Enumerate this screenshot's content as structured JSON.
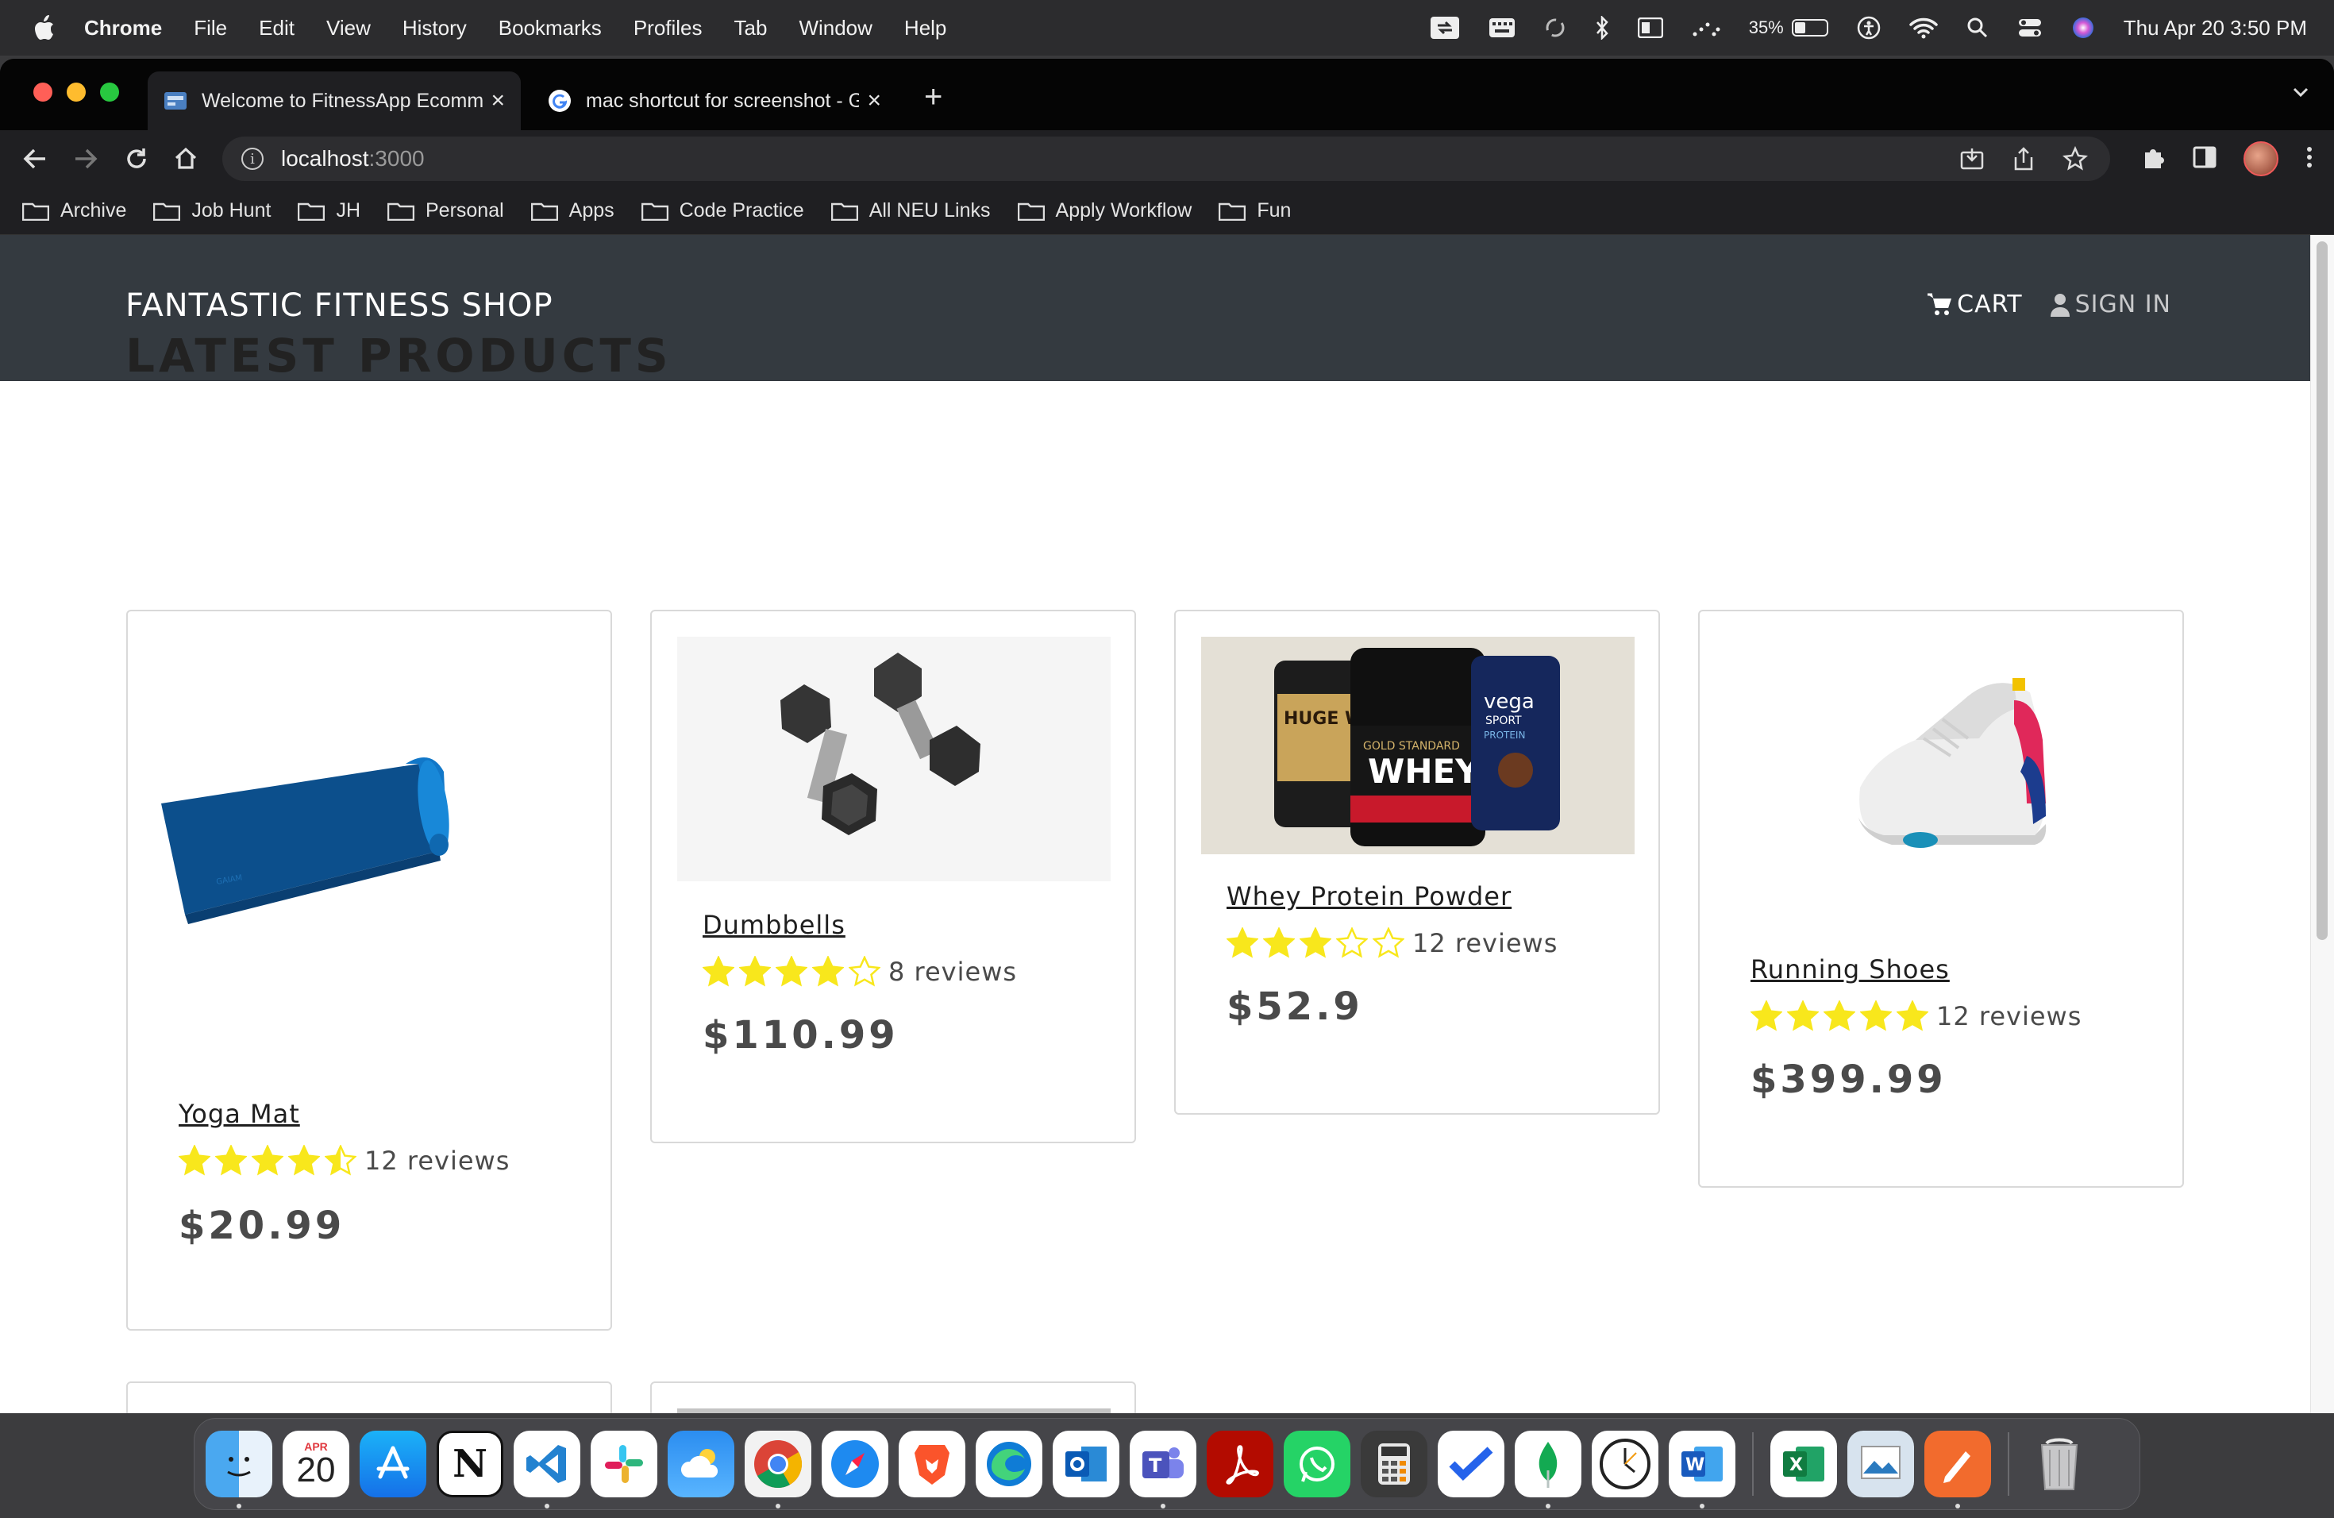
{
  "menubar": {
    "app_name": "Chrome",
    "items": [
      "File",
      "Edit",
      "View",
      "History",
      "Bookmarks",
      "Profiles",
      "Tab",
      "Window",
      "Help"
    ],
    "battery_percent": "35%",
    "battery_level": 0.35,
    "datetime": "Thu Apr 20  3:50 PM"
  },
  "browser": {
    "tabs": [
      {
        "title": "Welcome to FitnessApp Ecomm",
        "active": true,
        "favicon": "site-favicon"
      },
      {
        "title": "mac shortcut for screenshot - G",
        "active": false,
        "favicon": "google-icon"
      }
    ],
    "address": {
      "host": "localhost",
      "port": ":3000"
    },
    "bookmarks": [
      "Archive",
      "Job Hunt",
      "JH",
      "Personal",
      "Apps",
      "Code Practice",
      "All NEU Links",
      "Apply Workflow",
      "Fun"
    ]
  },
  "site": {
    "brand": "FANTASTIC FITNESS SHOP",
    "nav": {
      "cart": "CART",
      "sign_in": "SIGN IN"
    },
    "section_title": "LATEST PRODUCTS",
    "products": [
      {
        "name": "Yoga Mat",
        "rating": 4.5,
        "reviews": "12 reviews",
        "price": "$20.99",
        "image": "yoga-mat"
      },
      {
        "name": "Dumbbells",
        "rating": 4,
        "reviews": "8 reviews",
        "price": "$110.99",
        "image": "dumbbells"
      },
      {
        "name": "Whey Protein Powder",
        "rating": 3,
        "reviews": "12 reviews",
        "price": "$52.9",
        "image": "whey-protein"
      },
      {
        "name": "Running Shoes",
        "rating": 5,
        "reviews": "12 reviews",
        "price": "$399.99",
        "image": "running-shoes"
      }
    ],
    "whey_labels": {
      "huge": "HUGE WHEY",
      "gold": "GOLD STANDARD",
      "whey": "WHEY",
      "vega": "vega",
      "sport": "SPORT",
      "protein": "PROTEIN"
    },
    "star_color": "#f8e71c",
    "header_color": "#343a40"
  },
  "dock": {
    "calendar_month": "APR",
    "calendar_day": "20",
    "apps": [
      "finder",
      "calendar",
      "app-store",
      "notion",
      "vscode",
      "slack",
      "weather",
      "chrome",
      "safari",
      "brave",
      "edge",
      "outlook",
      "teams",
      "acrobat",
      "whatsapp",
      "calculator",
      "tasks",
      "mongodb",
      "clock",
      "word",
      "excel",
      "preview",
      "pen-tool",
      "trash"
    ]
  }
}
